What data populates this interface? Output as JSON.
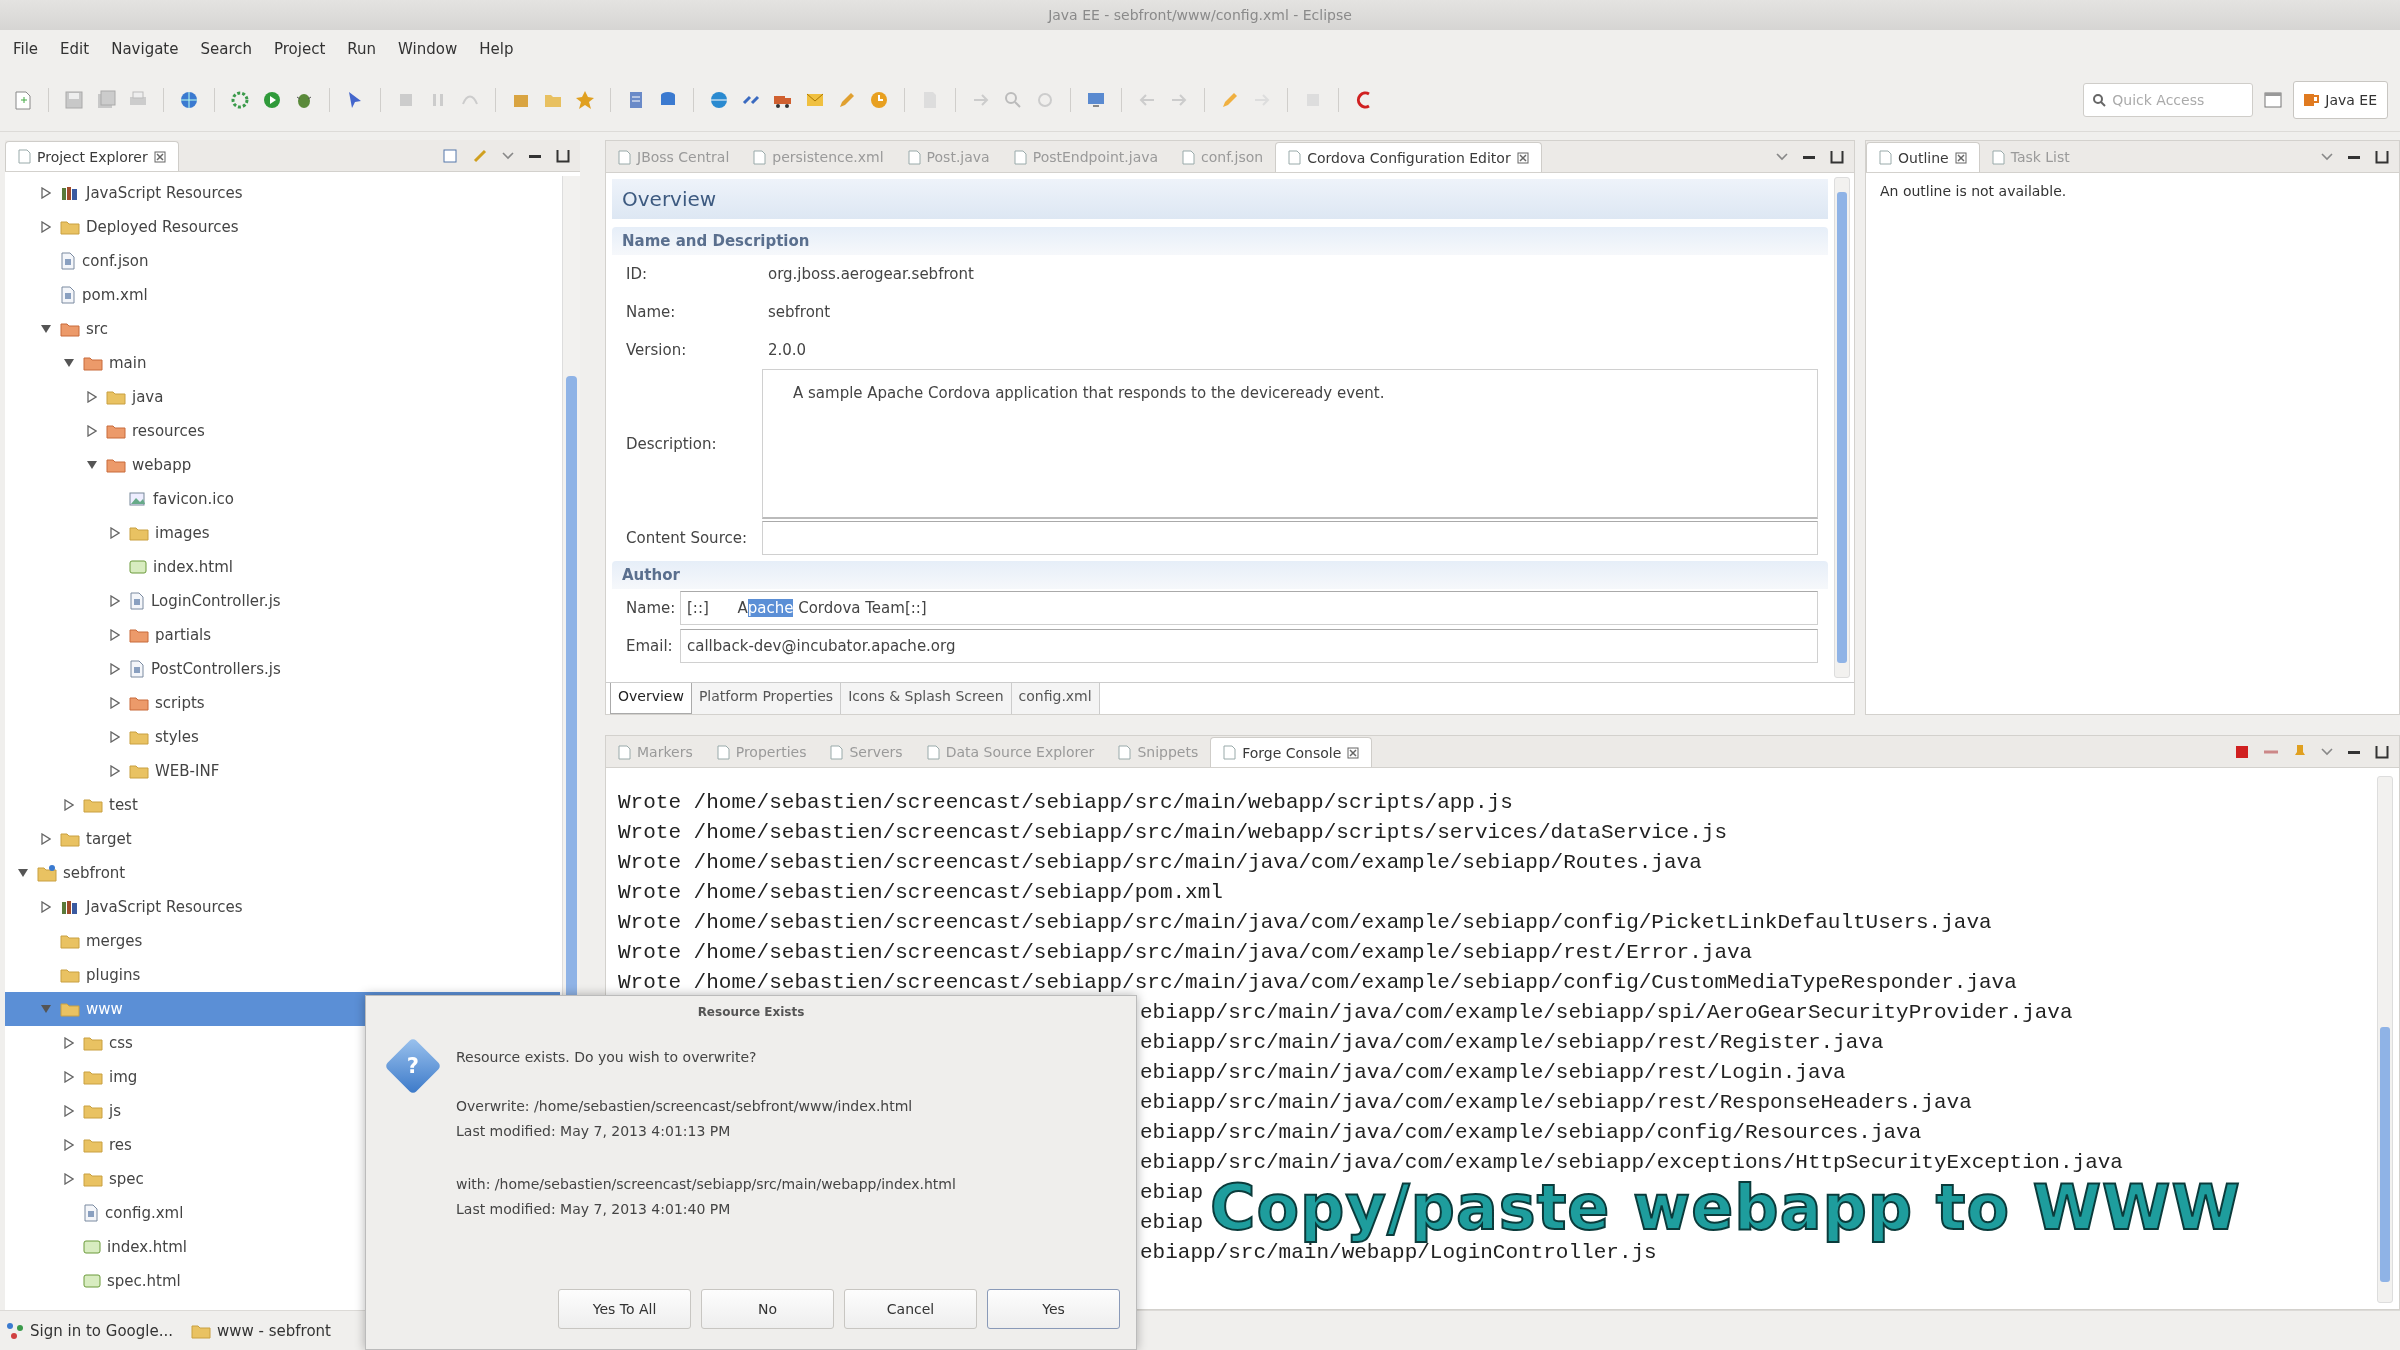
{
  "window": {
    "title": "Java EE - sebfront/www/config.xml - Eclipse"
  },
  "menu": [
    "File",
    "Edit",
    "Navigate",
    "Search",
    "Project",
    "Run",
    "Window",
    "Help"
  ],
  "toolbar": {
    "quick_access": {
      "placeholder": "Quick Access"
    },
    "perspective": {
      "label": "Java EE",
      "selected": true
    }
  },
  "project_explorer": {
    "tabs": [
      {
        "label": "Project Explorer",
        "selected": true
      }
    ],
    "tree": [
      {
        "children": [
          {
            "label": "JavaScript Resources",
            "kind": "library",
            "expanded": false,
            "selected": false
          },
          {
            "label": "Deployed Resources",
            "kind": "folder",
            "expanded": false,
            "selected": false
          },
          {
            "label": "conf.json",
            "kind": "file",
            "selected": false
          },
          {
            "label": "pom.xml",
            "kind": "file",
            "selected": false
          },
          {
            "label": "src",
            "kind": "source-folder",
            "expanded": true,
            "selected": false,
            "children": [
              {
                "label": "main",
                "kind": "source-folder",
                "expanded": true,
                "selected": false,
                "children": [
                  {
                    "label": "java",
                    "kind": "folder",
                    "expanded": false,
                    "selected": false
                  },
                  {
                    "label": "resources",
                    "kind": "source-folder",
                    "expanded": false,
                    "selected": false
                  },
                  {
                    "label": "webapp",
                    "kind": "source-folder",
                    "expanded": true,
                    "selected": false,
                    "children": [
                      {
                        "label": "favicon.ico",
                        "kind": "image",
                        "selected": false
                      },
                      {
                        "label": "images",
                        "kind": "folder",
                        "expanded": false,
                        "selected": false
                      },
                      {
                        "label": "index.html",
                        "kind": "html",
                        "selected": false
                      },
                      {
                        "label": "LoginController.js",
                        "kind": "file",
                        "expanded": false,
                        "selected": false
                      },
                      {
                        "label": "partials",
                        "kind": "source-folder",
                        "expanded": false,
                        "selected": false
                      },
                      {
                        "label": "PostControllers.js",
                        "kind": "file",
                        "expanded": false,
                        "selected": false
                      },
                      {
                        "label": "scripts",
                        "kind": "source-folder",
                        "expanded": false,
                        "selected": false
                      },
                      {
                        "label": "styles",
                        "kind": "folder",
                        "expanded": false,
                        "selected": false
                      },
                      {
                        "label": "WEB-INF",
                        "kind": "folder",
                        "expanded": false,
                        "selected": false
                      }
                    ]
                  }
                ]
              },
              {
                "label": "test",
                "kind": "folder",
                "expanded": false,
                "selected": false
              }
            ]
          },
          {
            "label": "target",
            "kind": "folder",
            "expanded": false,
            "selected": false
          }
        ]
      },
      {
        "label": "sebfront",
        "kind": "project",
        "expanded": true,
        "selected": false,
        "children": [
          {
            "label": "JavaScript Resources",
            "kind": "library",
            "expanded": false,
            "selected": false
          },
          {
            "label": "merges",
            "kind": "folder",
            "selected": false
          },
          {
            "label": "plugins",
            "kind": "folder",
            "selected": false
          },
          {
            "label": "www",
            "kind": "folder",
            "expanded": true,
            "selected": true,
            "children": [
              {
                "label": "css",
                "kind": "folder",
                "expanded": false,
                "selected": false
              },
              {
                "label": "img",
                "kind": "folder",
                "expanded": false,
                "selected": false
              },
              {
                "label": "js",
                "kind": "folder",
                "expanded": false,
                "selected": false
              },
              {
                "label": "res",
                "kind": "folder",
                "expanded": false,
                "selected": false
              },
              {
                "label": "spec",
                "kind": "folder",
                "expanded": false,
                "selected": false
              },
              {
                "label": "config.xml",
                "kind": "file",
                "selected": false
              },
              {
                "label": "index.html",
                "kind": "html",
                "selected": false
              },
              {
                "label": "spec.html",
                "kind": "html",
                "selected": false
              }
            ]
          }
        ]
      }
    ]
  },
  "editor": {
    "tabs": [
      {
        "label": "JBoss Central",
        "selected": false
      },
      {
        "label": "persistence.xml",
        "selected": false
      },
      {
        "label": "Post.java",
        "selected": false
      },
      {
        "label": "PostEndpoint.java",
        "selected": false
      },
      {
        "label": "conf.json",
        "selected": false
      },
      {
        "label": "Cordova Configuration Editor",
        "selected": true
      }
    ],
    "form": {
      "title": "Overview",
      "sections": [
        {
          "title": "Name and Description",
          "fields": [
            {
              "label": "ID:",
              "kind": "text",
              "value": "org.jboss.aerogear.sebfront"
            },
            {
              "label": "Name:",
              "kind": "text",
              "value": "sebfront"
            },
            {
              "label": "Version:",
              "kind": "text",
              "value": "2.0.0"
            },
            {
              "label": "Description:",
              "kind": "textarea",
              "value": "A sample Apache Cordova application that responds to the deviceready event."
            },
            {
              "label": "Content Source:",
              "kind": "box"
            }
          ]
        },
        {
          "title": "Author",
          "fields": [
            {
              "label": "Name:",
              "kind": "box",
              "parts": [
                {
                  "text": "[::]      A",
                  "selected": false
                },
                {
                  "text": "pache",
                  "selected": true
                },
                {
                  "text": " Cordova Team[::]",
                  "selected": false
                }
              ]
            },
            {
              "label": "Email:",
              "kind": "box",
              "value": "callback-dev@incubator.apache.org"
            }
          ]
        }
      ]
    },
    "pages": [
      {
        "label": "Overview",
        "selected": true
      },
      {
        "label": "Platform Properties",
        "selected": false
      },
      {
        "label": "Icons & Splash Screen",
        "selected": false
      },
      {
        "label": "config.xml",
        "selected": false
      }
    ]
  },
  "outline": {
    "tabs": [
      {
        "label": "Outline",
        "selected": true
      },
      {
        "label": "Task List",
        "selected": false
      }
    ],
    "message": "An outline is not available."
  },
  "console": {
    "tabs": [
      {
        "label": "Markers",
        "selected": false
      },
      {
        "label": "Properties",
        "selected": false
      },
      {
        "label": "Servers",
        "selected": false
      },
      {
        "label": "Data Source Explorer",
        "selected": false
      },
      {
        "label": "Snippets",
        "selected": false
      },
      {
        "label": "Forge Console",
        "selected": true
      }
    ],
    "lines": [
      {
        "kind": "full",
        "text": "Wrote /home/sebastien/screencast/sebiapp/src/main/webapp/scripts/app.js"
      },
      {
        "kind": "full",
        "text": "Wrote /home/sebastien/screencast/sebiapp/src/main/webapp/scripts/services/dataService.js"
      },
      {
        "kind": "full",
        "text": "Wrote /home/sebastien/screencast/sebiapp/src/main/java/com/example/sebiapp/Routes.java"
      },
      {
        "kind": "full",
        "text": "Wrote /home/sebastien/screencast/sebiapp/pom.xml"
      },
      {
        "kind": "full",
        "text": "Wrote /home/sebastien/screencast/sebiapp/src/main/java/com/example/sebiapp/config/PicketLinkDefaultUsers.java"
      },
      {
        "kind": "full",
        "text": "Wrote /home/sebastien/screencast/sebiapp/src/main/java/com/example/sebiapp/rest/Error.java"
      },
      {
        "kind": "full",
        "text": "Wrote /home/sebastien/screencast/sebiapp/src/main/java/com/example/sebiapp/config/CustomMediaTypeResponder.java"
      },
      {
        "kind": "partial",
        "text": "ebiapp/src/main/java/com/example/sebiapp/spi/AeroGearSecurityProvider.java"
      },
      {
        "kind": "partial",
        "text": "ebiapp/src/main/java/com/example/sebiapp/rest/Register.java"
      },
      {
        "kind": "partial",
        "text": "ebiapp/src/main/java/com/example/sebiapp/rest/Login.java"
      },
      {
        "kind": "partial",
        "text": "ebiapp/src/main/java/com/example/sebiapp/rest/ResponseHeaders.java"
      },
      {
        "kind": "partial",
        "text": "ebiapp/src/main/java/com/example/sebiapp/config/Resources.java"
      },
      {
        "kind": "partial",
        "text": "ebiapp/src/main/java/com/example/sebiapp/exceptions/HttpSecurityException.java"
      },
      {
        "kind": "partial",
        "text": "ebiap"
      },
      {
        "kind": "partial",
        "text": "ebiap"
      },
      {
        "kind": "partial",
        "text": "ebiapp/src/main/webapp/LoginController.js"
      }
    ]
  },
  "dialog": {
    "title": "Resource Exists",
    "icon": "?",
    "message": "Resource exists. Do you wish to overwrite?",
    "detail_groups": [
      {
        "lines": [
          "Overwrite: /home/sebastien/screencast/sebfront/www/index.html",
          "Last modified: May 7, 2013 4:01:13 PM"
        ]
      },
      {
        "lines": [
          "with: /home/sebastien/screencast/sebiapp/src/main/webapp/index.html",
          "Last modified: May 7, 2013 4:01:40 PM"
        ]
      }
    ],
    "buttons": [
      {
        "label": "Yes To All",
        "default": false
      },
      {
        "label": "No",
        "default": false
      },
      {
        "label": "Cancel",
        "default": false
      },
      {
        "label": "Yes",
        "default": true
      }
    ]
  },
  "caption": "Copy/paste webapp to WWW",
  "status_bar": [
    {
      "label": "Sign in to Google...",
      "kind": "google"
    },
    {
      "label": "www - sebfront",
      "kind": "folder"
    }
  ]
}
